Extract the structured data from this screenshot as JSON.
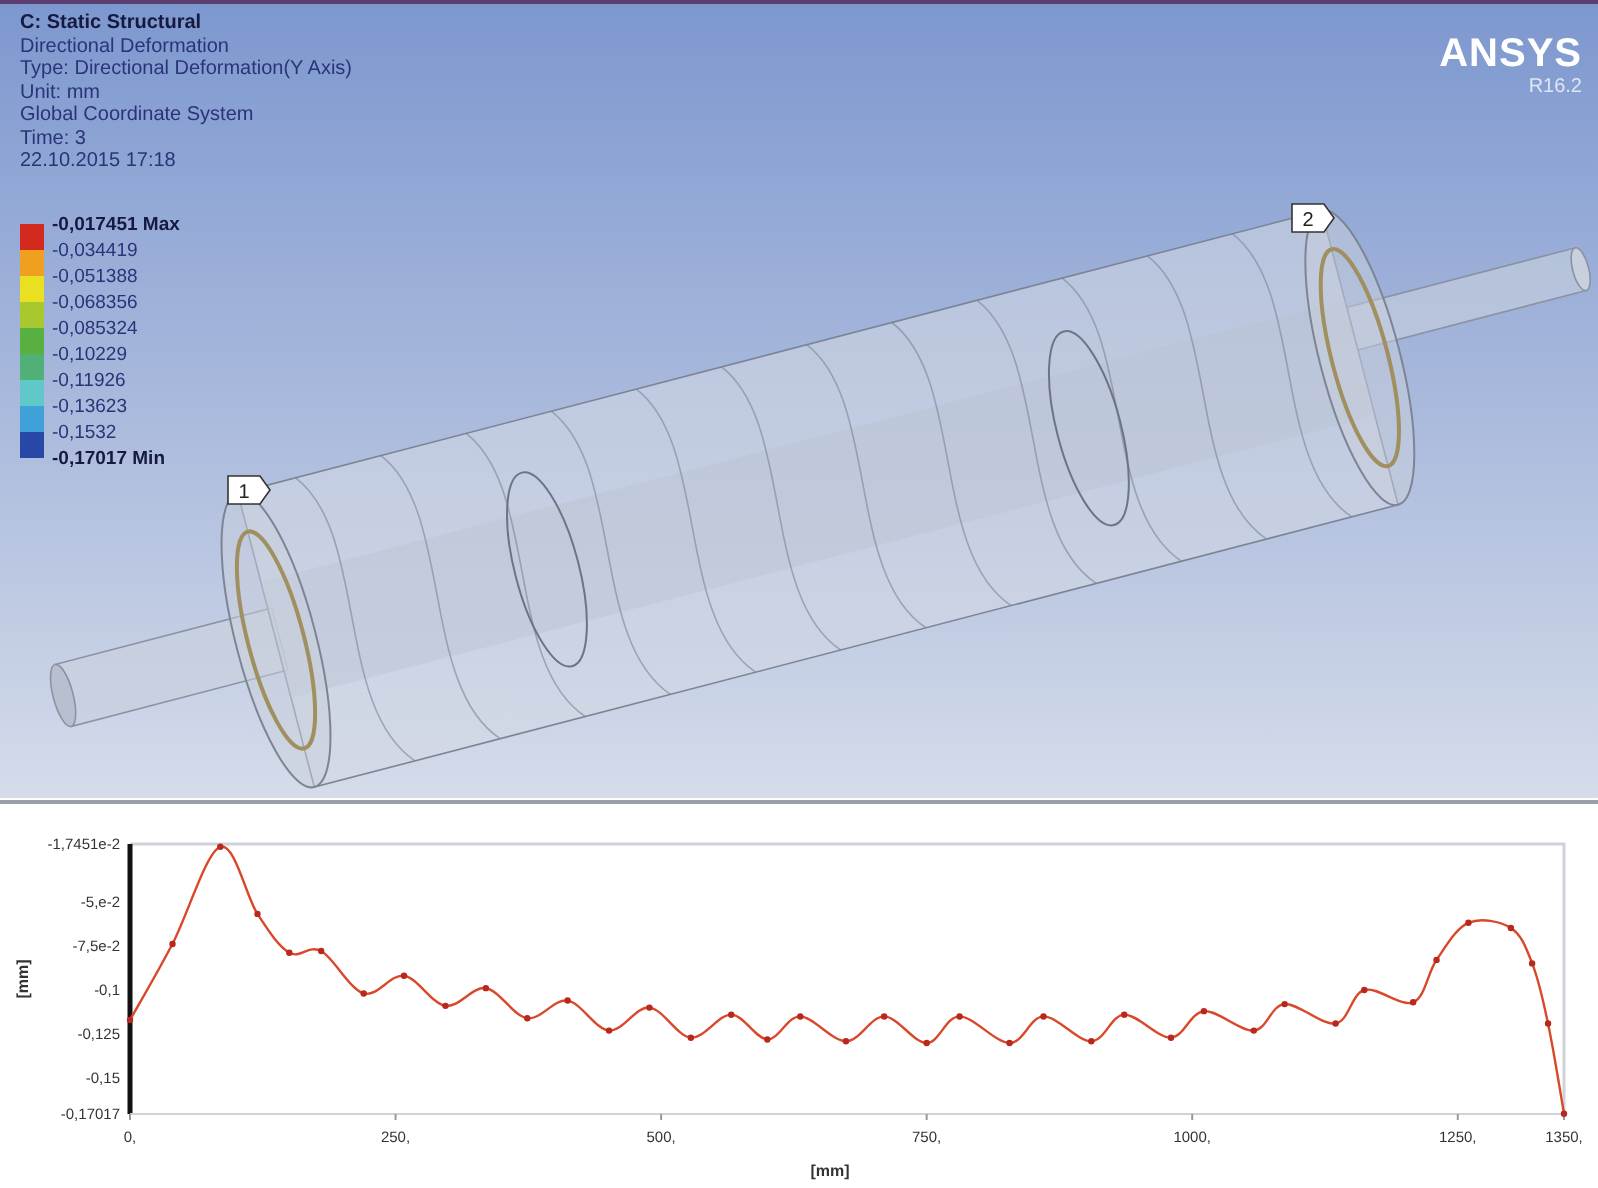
{
  "viewport": {
    "header": {
      "title": "C: Static Structural",
      "lines": [
        "Directional Deformation",
        "Type: Directional Deformation(Y Axis)",
        "Unit: mm",
        "Global Coordinate System",
        "Time: 3",
        "22.10.2015 17:18"
      ]
    },
    "legend": {
      "entries": [
        {
          "label": "-0,017451 Max",
          "kind": "max"
        },
        {
          "label": "-0,034419",
          "kind": "level"
        },
        {
          "label": "-0,051388",
          "kind": "level"
        },
        {
          "label": "-0,068356",
          "kind": "level"
        },
        {
          "label": "-0,085324",
          "kind": "level"
        },
        {
          "label": "-0,10229",
          "kind": "level"
        },
        {
          "label": "-0,11926",
          "kind": "level"
        },
        {
          "label": "-0,13623",
          "kind": "level"
        },
        {
          "label": "-0,1532",
          "kind": "level"
        },
        {
          "label": "-0,17017 Min",
          "kind": "min"
        }
      ],
      "bands": [
        {
          "color": "#d42a1e"
        },
        {
          "color": "#f0a020"
        },
        {
          "color": "#e8e020"
        },
        {
          "color": "#a8c830"
        },
        {
          "color": "#58b040"
        },
        {
          "color": "#50b078"
        },
        {
          "color": "#60c8c8"
        },
        {
          "color": "#40a0d8"
        },
        {
          "color": "#2848a8"
        }
      ]
    },
    "logo": {
      "name": "ANSYS",
      "version": "R16.2"
    },
    "probes": [
      {
        "label": "1"
      },
      {
        "label": "2"
      }
    ]
  },
  "chart_panel": {
    "chart_data": {
      "type": "line",
      "xlabel": "[mm]",
      "ylabel": "[mm]",
      "x": [
        0,
        40,
        85,
        120,
        150,
        180,
        220,
        258,
        297,
        335,
        374,
        412,
        451,
        489,
        528,
        566,
        600,
        631,
        674,
        710,
        750,
        781,
        828,
        860,
        905,
        936,
        980,
        1011,
        1058,
        1087,
        1135,
        1162,
        1208,
        1230,
        1260,
        1300,
        1320,
        1335,
        1350
      ],
      "series": [
        {
          "color": "#d9482a",
          "marker": "circle",
          "values": [
            -0.117,
            -0.074,
            -0.019,
            -0.057,
            -0.079,
            -0.078,
            -0.102,
            -0.092,
            -0.109,
            -0.099,
            -0.116,
            -0.106,
            -0.123,
            -0.11,
            -0.127,
            -0.114,
            -0.128,
            -0.115,
            -0.129,
            -0.115,
            -0.13,
            -0.115,
            -0.13,
            -0.115,
            -0.129,
            -0.114,
            -0.127,
            -0.112,
            -0.123,
            -0.108,
            -0.119,
            -0.1,
            -0.107,
            -0.083,
            -0.062,
            -0.065,
            -0.085,
            -0.119,
            -0.17
          ]
        }
      ],
      "xlim": [
        0,
        1350
      ],
      "ylim": [
        -0.17017,
        -0.017451
      ],
      "xticks": [
        {
          "value": 0,
          "label": "0,"
        },
        {
          "value": 250,
          "label": "250,"
        },
        {
          "value": 500,
          "label": "500,"
        },
        {
          "value": 750,
          "label": "750,"
        },
        {
          "value": 1000,
          "label": "1000,"
        },
        {
          "value": 1250,
          "label": "1250,"
        },
        {
          "value": 1350,
          "label": "1350,"
        }
      ],
      "yticks": [
        {
          "value": -0.017451,
          "label": "-1,7451e-2"
        },
        {
          "value": -0.05,
          "label": "-5,e-2"
        },
        {
          "value": -0.075,
          "label": "-7,5e-2"
        },
        {
          "value": -0.1,
          "label": "-0,1"
        },
        {
          "value": -0.125,
          "label": "-0,125"
        },
        {
          "value": -0.15,
          "label": "-0,15"
        },
        {
          "value": -0.17017,
          "label": "-0,17017"
        }
      ]
    }
  }
}
